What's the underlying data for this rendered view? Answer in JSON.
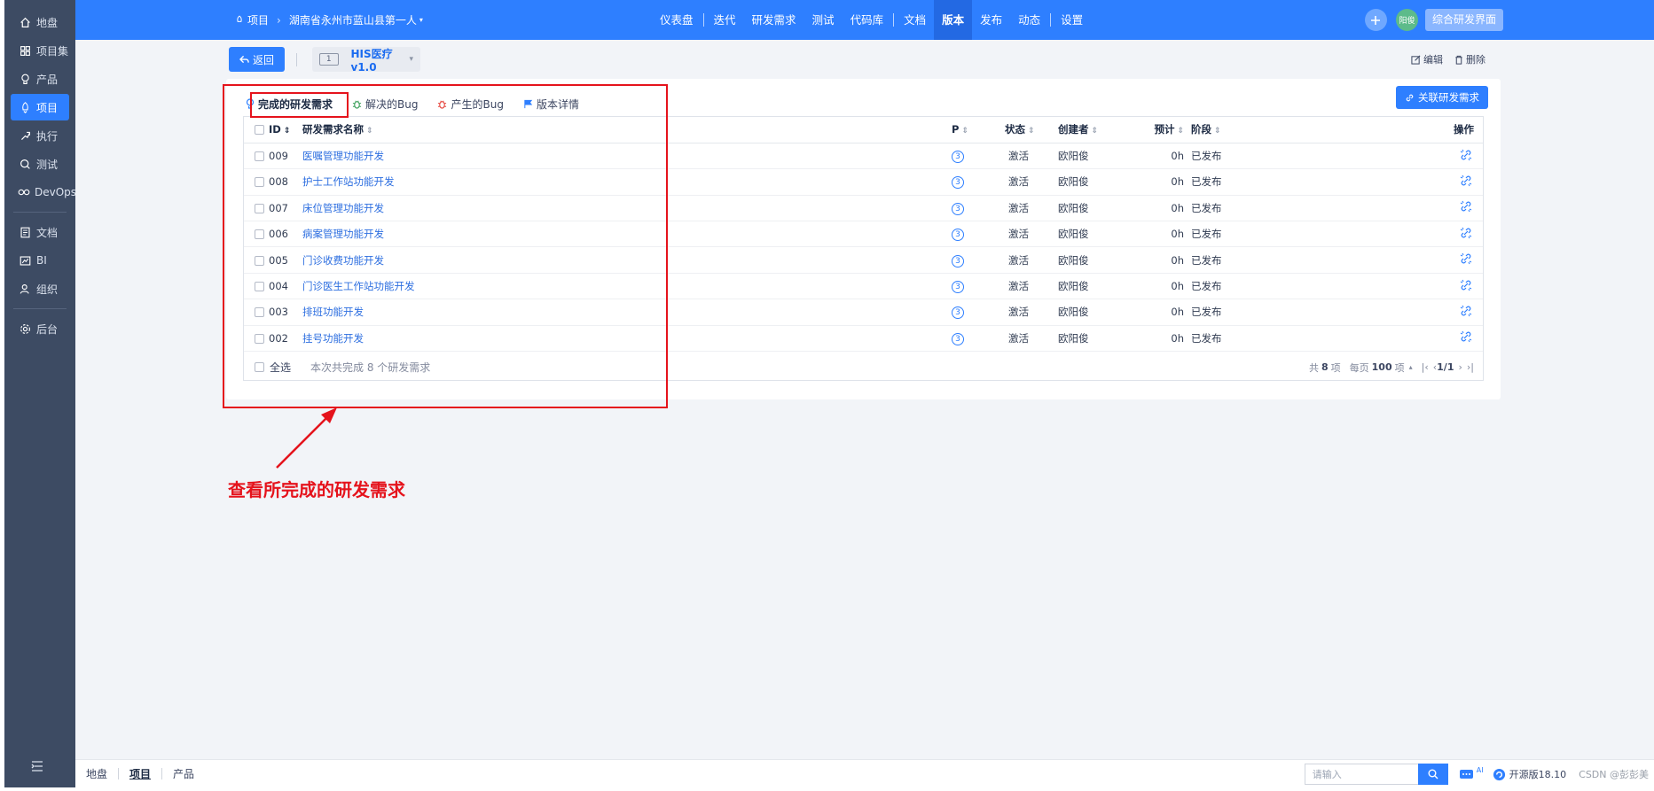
{
  "sidebar": {
    "items": [
      {
        "label": "地盘",
        "icon": "home-icon"
      },
      {
        "label": "项目集",
        "icon": "grid-icon"
      },
      {
        "label": "产品",
        "icon": "lightbulb-icon"
      },
      {
        "label": "项目",
        "icon": "rocket-icon",
        "active": true
      },
      {
        "label": "执行",
        "icon": "run-icon"
      },
      {
        "label": "测试",
        "icon": "magnifier-icon"
      },
      {
        "label": "DevOps",
        "icon": "infinity-icon"
      },
      {
        "label": "文档",
        "icon": "doc-icon"
      },
      {
        "label": "BI",
        "icon": "chart-icon"
      },
      {
        "label": "组织",
        "icon": "people-icon"
      },
      {
        "label": "后台",
        "icon": "gear-icon"
      }
    ]
  },
  "header": {
    "breadcrumb": {
      "root": "项目",
      "project": "湖南省永州市蓝山县第一人"
    },
    "nav": [
      "仪表盘",
      "迭代",
      "研发需求",
      "测试",
      "代码库",
      "文档",
      "版本",
      "发布",
      "动态",
      "设置"
    ],
    "active_nav": "版本",
    "avatar_text": "阳俊",
    "switch_label": "综合研发界面"
  },
  "toolbar": {
    "back_label": "返回",
    "version_num": "1",
    "version_name": "HIS医疗v1.0",
    "edit_label": "编辑",
    "delete_label": "删除"
  },
  "tabs": [
    {
      "label": "完成的研发需求",
      "active": true
    },
    {
      "label": "解决的Bug"
    },
    {
      "label": "产生的Bug"
    },
    {
      "label": "版本详情"
    }
  ],
  "link_story_label": "关联研发需求",
  "table": {
    "columns": {
      "id": "ID",
      "name": "研发需求名称",
      "pri": "P",
      "status": "状态",
      "creator": "创建者",
      "estimate": "预计",
      "stage": "阶段",
      "actions": "操作"
    },
    "rows": [
      {
        "id": "009",
        "name": "医嘱管理功能开发",
        "pri": "3",
        "status": "激活",
        "creator": "欧阳俊",
        "estimate": "0h",
        "stage": "已发布"
      },
      {
        "id": "008",
        "name": "护士工作站功能开发",
        "pri": "3",
        "status": "激活",
        "creator": "欧阳俊",
        "estimate": "0h",
        "stage": "已发布"
      },
      {
        "id": "007",
        "name": "床位管理功能开发",
        "pri": "3",
        "status": "激活",
        "creator": "欧阳俊",
        "estimate": "0h",
        "stage": "已发布"
      },
      {
        "id": "006",
        "name": "病案管理功能开发",
        "pri": "3",
        "status": "激活",
        "creator": "欧阳俊",
        "estimate": "0h",
        "stage": "已发布"
      },
      {
        "id": "005",
        "name": "门诊收费功能开发",
        "pri": "3",
        "status": "激活",
        "creator": "欧阳俊",
        "estimate": "0h",
        "stage": "已发布"
      },
      {
        "id": "004",
        "name": "门诊医生工作站功能开发",
        "pri": "3",
        "status": "激活",
        "creator": "欧阳俊",
        "estimate": "0h",
        "stage": "已发布"
      },
      {
        "id": "003",
        "name": "排班功能开发",
        "pri": "3",
        "status": "激活",
        "creator": "欧阳俊",
        "estimate": "0h",
        "stage": "已发布"
      },
      {
        "id": "002",
        "name": "挂号功能开发",
        "pri": "3",
        "status": "激活",
        "creator": "欧阳俊",
        "estimate": "0h",
        "stage": "已发布"
      }
    ],
    "footer": {
      "select_all": "全选",
      "summary": "本次共完成 8 个研发需求",
      "total_prefix": "共",
      "total": "8",
      "total_suffix": "项",
      "per_page_prefix": "每页",
      "per_page": "100",
      "per_page_suffix": "项",
      "page": "1/1"
    }
  },
  "annotation": {
    "text": "查看所完成的研发需求",
    "color": "#e5131c"
  },
  "bottombar": {
    "links": [
      "地盘",
      "项目",
      "产品"
    ],
    "active": "项目",
    "search_placeholder": "请输入",
    "ai_label": "AI",
    "version_text": "开源版18.10",
    "watermark": "CSDN @彭彭美"
  },
  "colors": {
    "primary": "#2e7fff",
    "sidebar": "#3d4b63",
    "annotation": "#e5131c"
  }
}
